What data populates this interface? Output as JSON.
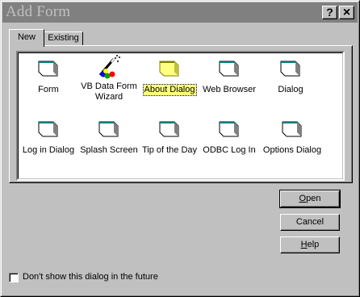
{
  "window": {
    "title": "Add Form",
    "help_button": "?",
    "close_button": "×"
  },
  "tabs": [
    {
      "label": "New",
      "active": true
    },
    {
      "label": "Existing",
      "active": false
    }
  ],
  "items": [
    {
      "label": "Form",
      "icon": "form-icon"
    },
    {
      "label": "VB Data Form Wizard",
      "icon": "wizard-icon"
    },
    {
      "label": "About Dialog",
      "icon": "form-icon",
      "selected": true
    },
    {
      "label": "Web Browser",
      "icon": "form-icon"
    },
    {
      "label": "Dialog",
      "icon": "form-icon"
    },
    {
      "label": "Log in Dialog",
      "icon": "form-icon"
    },
    {
      "label": "Splash Screen",
      "icon": "form-icon"
    },
    {
      "label": "Tip of the Day",
      "icon": "form-icon"
    },
    {
      "label": "ODBC Log In",
      "icon": "form-icon"
    },
    {
      "label": "Options Dialog",
      "icon": "form-icon"
    }
  ],
  "buttons": {
    "open": {
      "label": "Open",
      "mnemonic": "O",
      "rest": "pen"
    },
    "cancel": {
      "label": "Cancel"
    },
    "help": {
      "label": "Help",
      "mnemonic": "H",
      "rest": "elp"
    }
  },
  "checkbox": {
    "label": "Don't show this dialog in the future",
    "checked": false
  },
  "colors": {
    "face": "#c0c0c0",
    "titlebar": "#808080",
    "selection": "#ffff80"
  }
}
